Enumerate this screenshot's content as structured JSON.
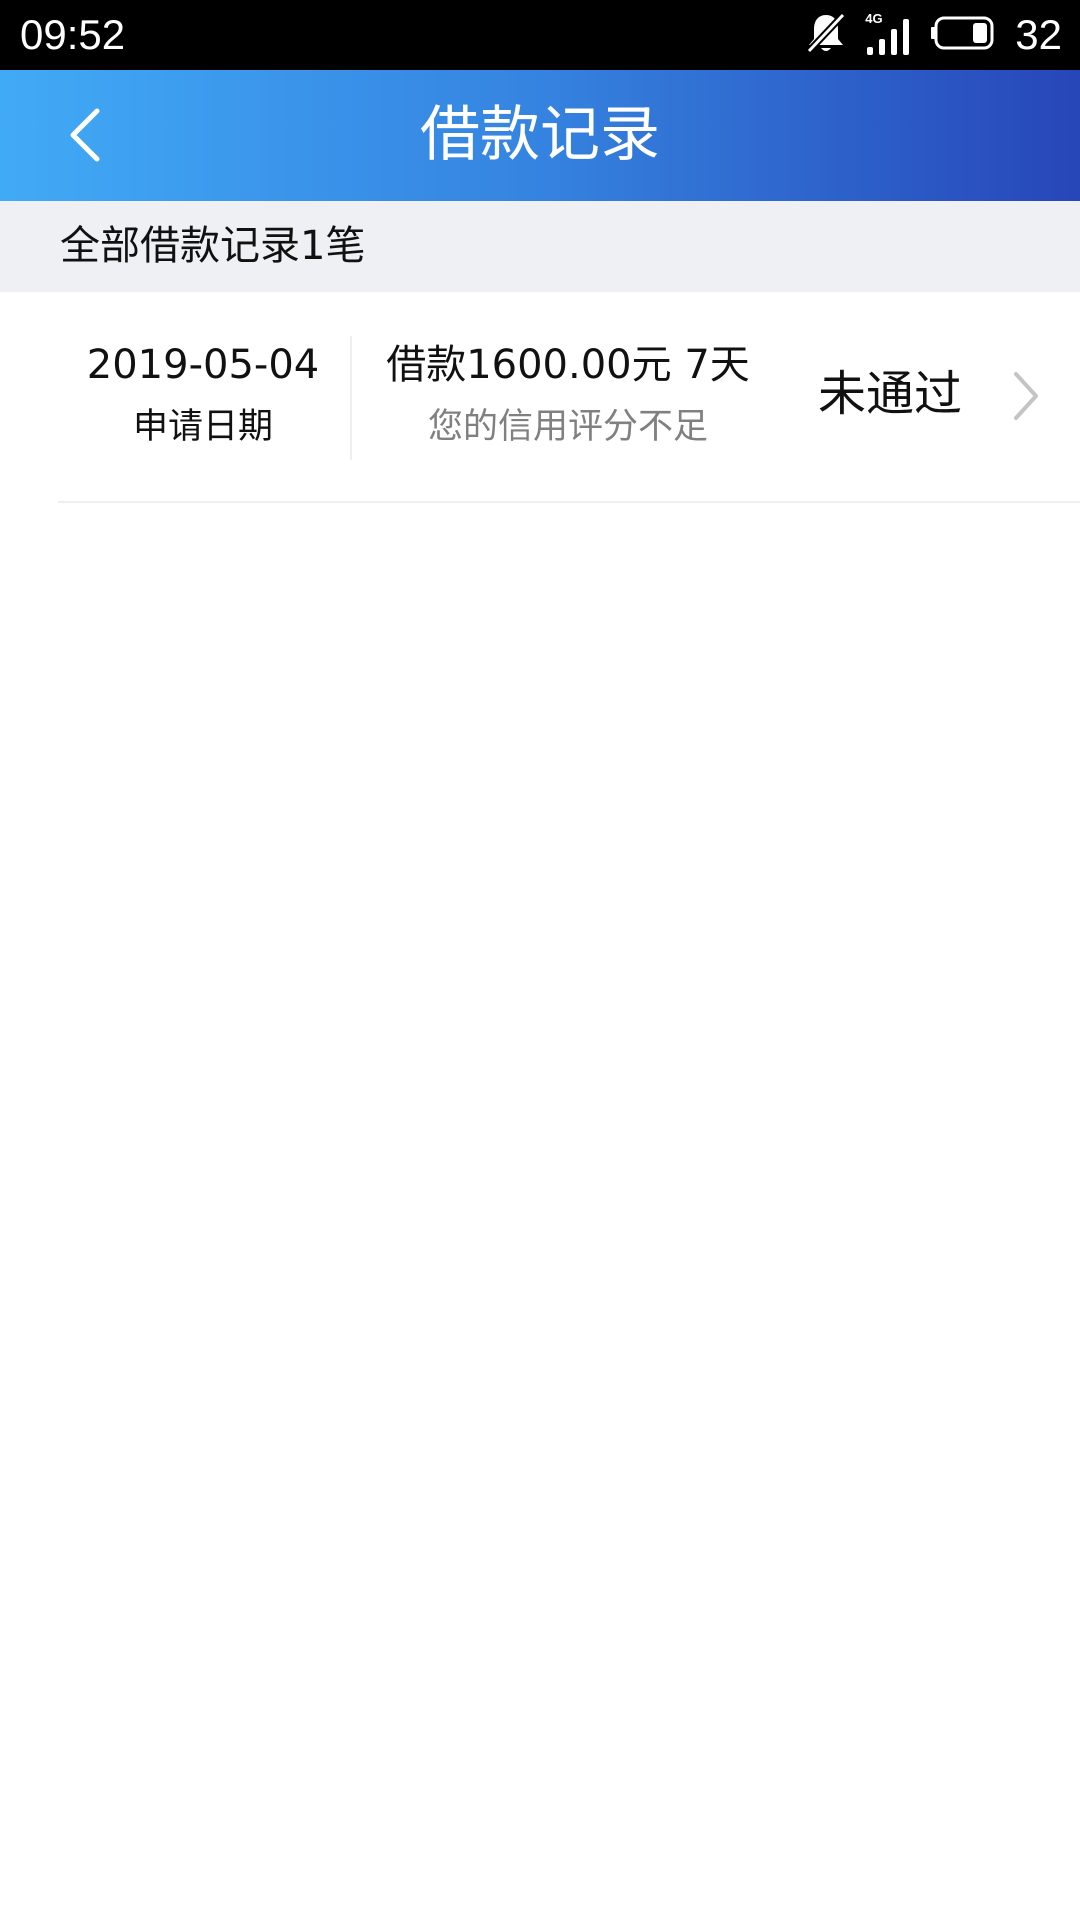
{
  "status_bar": {
    "time": "09:52",
    "network": "4G",
    "battery_level": "32",
    "icons": [
      "bell-muted-icon",
      "signal-icon",
      "battery-icon"
    ]
  },
  "header": {
    "title": "借款记录",
    "back_icon": "chevron-left-icon",
    "gradient_colors": [
      "#41aaf6",
      "#3583e0",
      "#2746b8"
    ]
  },
  "summary": {
    "text": "全部借款记录1笔"
  },
  "records": [
    {
      "date": "2019-05-04",
      "date_label": "申请日期",
      "loan_summary": "借款1600.00元 7天",
      "reason": "您的信用评分不足",
      "status": "未通过",
      "chevron_icon": "chevron-right-icon"
    }
  ]
}
